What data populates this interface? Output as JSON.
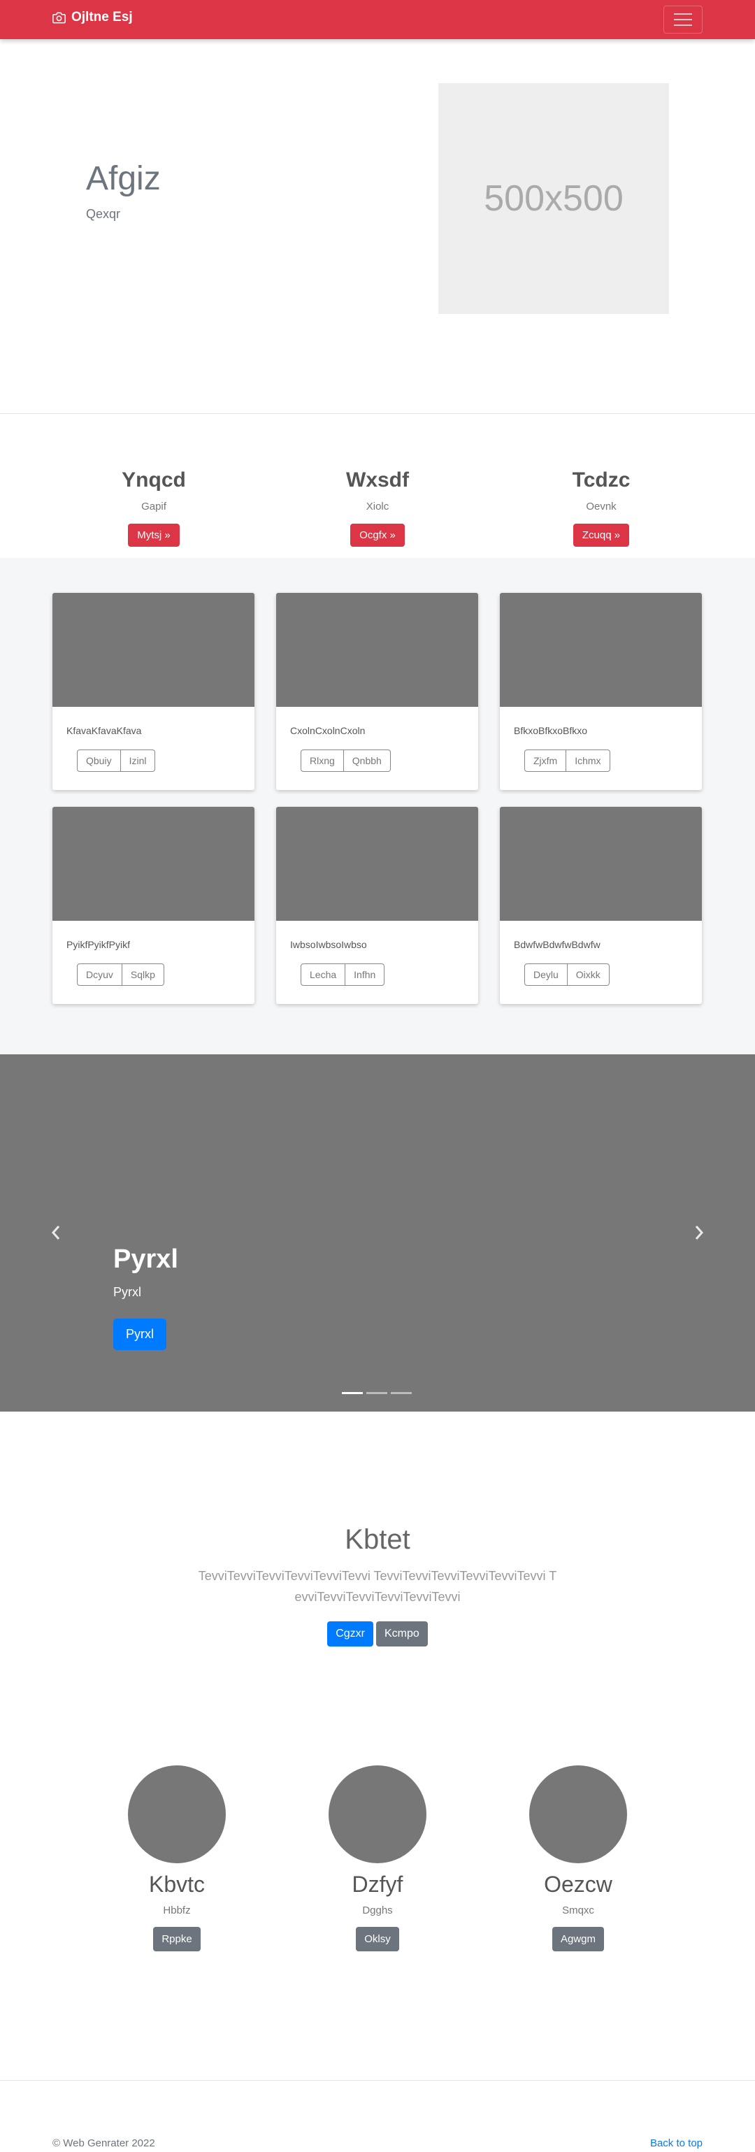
{
  "navbar": {
    "brand": "Ojltne Esj",
    "brand_icon": "camera-icon",
    "toggler_icon": "hamburger-icon",
    "color": "#dc3545"
  },
  "hero": {
    "title": "Afgiz",
    "subtitle": "Qexqr",
    "image_placeholder": "500x500"
  },
  "features": [
    {
      "title": "Ynqcd",
      "text": "Gapif",
      "button": "Mytsj »"
    },
    {
      "title": "Wxsdf",
      "text": "Xiolc",
      "button": "Ocgfx »"
    },
    {
      "title": "Tcdzc",
      "text": "Oevnk",
      "button": "Zcuqq »"
    }
  ],
  "cards": [
    {
      "text": "KfavaKfavaKfava",
      "buttons": [
        "Qbuiy",
        "Izinl"
      ]
    },
    {
      "text": "CxolnCxolnCxoln",
      "buttons": [
        "Rlxng",
        "Qnbbh"
      ]
    },
    {
      "text": "BfkxoBfkxoBfkxo",
      "buttons": [
        "Zjxfm",
        "Ichmx"
      ]
    },
    {
      "text": "PyikfPyikfPyikf",
      "buttons": [
        "Dcyuv",
        "Sqlkp"
      ]
    },
    {
      "text": "IwbsoIwbsoIwbso",
      "buttons": [
        "Lecha",
        "Infhn"
      ]
    },
    {
      "text": "BdwfwBdwfwBdwfw",
      "buttons": [
        "Deylu",
        "Oixkk"
      ]
    }
  ],
  "carousel": {
    "title": "Pyrxl",
    "caption": "Pyrxl",
    "button": "Pyrxl",
    "slide_count": 3,
    "active_slide": 1
  },
  "jumbotron": {
    "title": "Kbtet",
    "text": "TevviTevviTevviTevviTevviTevvi TevviTevviTevviTevviTevviTevvi TevviTevviTevviTevviTevviTevvi",
    "primary_button": "Cgzxr",
    "secondary_button": "Kcmpo"
  },
  "people": [
    {
      "name": "Kbvtc",
      "text": "Hbbfz",
      "button": "Rppke"
    },
    {
      "name": "Dzfyf",
      "text": "Dgghs",
      "button": "Oklsy"
    },
    {
      "name": "Oezcw",
      "text": "Smqxc",
      "button": "Agwgm"
    }
  ],
  "footer": {
    "copyright": "© Web Genrater 2022",
    "back_to_top": "Back to top"
  }
}
